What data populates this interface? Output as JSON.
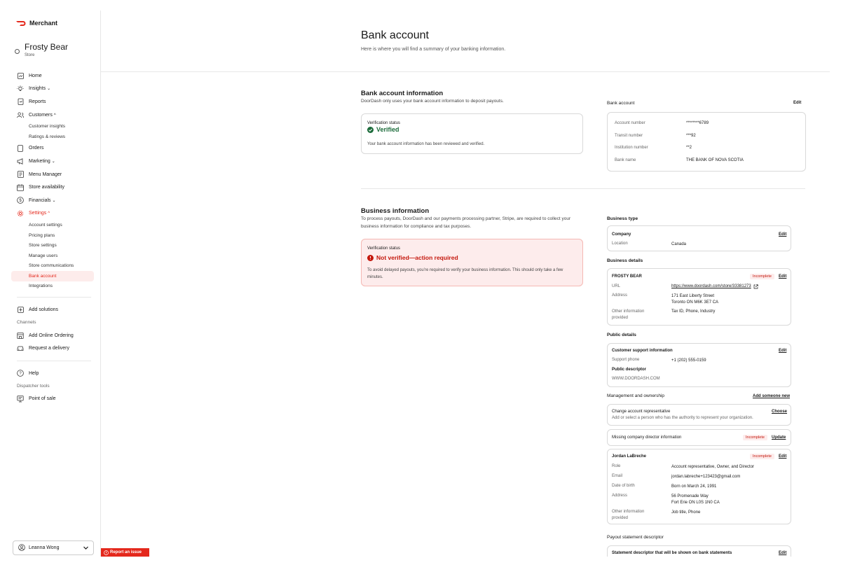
{
  "brand": {
    "name": "Merchant",
    "color": "#e4281c"
  },
  "store": {
    "name": "Frosty Bear",
    "type": "Store"
  },
  "nav": {
    "home": "Home",
    "insights": "Insights",
    "reports": "Reports",
    "customers": "Customers",
    "customer_insights": "Customer insights",
    "ratings_reviews": "Ratings & reviews",
    "orders": "Orders",
    "marketing": "Marketing",
    "menu_manager": "Menu Manager",
    "store_availability": "Store availability",
    "financials": "Financials",
    "settings": "Settings",
    "account_settings": "Account settings",
    "pricing_plans": "Pricing plans",
    "store_settings": "Store settings",
    "manage_users": "Manage users",
    "store_communications": "Store communications",
    "bank_account": "Bank account",
    "integrations": "Integrations",
    "add_solutions": "Add solutions",
    "channels_label": "Channels",
    "add_online_ordering": "Add Online Ordering",
    "request_delivery": "Request a delivery",
    "help": "Help",
    "dispatcher_label": "Dispatcher tools",
    "point_of_sale": "Point of sale"
  },
  "user": {
    "name": "Leanna Wong"
  },
  "report_issue": "Report an issue",
  "page": {
    "title": "Bank account",
    "subtitle": "Here is where you will find a summary of your banking information."
  },
  "bank_info": {
    "heading": "Bank account information",
    "desc": "DoorDash only uses your bank account information to deposit payouts.",
    "status_label": "Verification status",
    "status": "Verified",
    "status_desc": "Your bank account information has been reviewed and verified.",
    "card_title": "Bank account",
    "edit": "Edit",
    "rows": [
      {
        "label": "Account number",
        "value": "********6789"
      },
      {
        "label": "Transit number",
        "value": "***92"
      },
      {
        "label": "Institution number",
        "value": "**2"
      },
      {
        "label": "Bank name",
        "value": "THE BANK OF NOVA SCOTIA"
      }
    ]
  },
  "business": {
    "heading": "Business information",
    "desc": "To process payouts, DoorDash and our payments processing partner, Stripe, are required to collect your business information for compliance and tax purposes.",
    "status_label": "Verification status",
    "status": "Not verified—action required",
    "status_desc": "To avoid delayed payouts, you’re required to verify your business information. This should only take a few minutes.",
    "type": {
      "title": "Business type",
      "name": "Company",
      "edit": "Edit",
      "location_label": "Location",
      "location": "Canada"
    },
    "details": {
      "title": "Business details",
      "name": "FROSTY BEAR",
      "badge": "Incomplete",
      "edit": "Edit",
      "url_label": "URL",
      "url": "https://www.doordash.com/store/33381273",
      "address_label": "Address",
      "address_line1": "171 East Liberty Street",
      "address_line2": "Toronto ON M6K 3E7 CA",
      "other_label_1": "Other information",
      "other_label_2": "provided",
      "other": "Tax ID, Phone, Industry"
    },
    "public": {
      "title": "Public details",
      "support_title": "Customer support information",
      "edit": "Edit",
      "phone_label": "Support phone",
      "phone": "+1 (202) 555-0159",
      "descriptor_title": "Public descriptor",
      "descriptor": "WWW.DOORDASH.COM"
    },
    "management": {
      "title": "Management and ownership",
      "add_new": "Add someone new",
      "rep_title": "Change account representative",
      "rep_desc": "Add or select a person who has the authority to represent your organization.",
      "choose": "Choose",
      "director_title": "Missing company director information",
      "director_badge": "Incomplete",
      "update": "Update",
      "person_name": "Jordan LaBreche",
      "person_badge": "Incomplete",
      "person_edit": "Edit",
      "role_label": "Role",
      "role": "Account representative, Owner, and Director",
      "email_label": "Email",
      "email": "jordan.labreche+123423@gmail.com",
      "dob_label": "Date of birth",
      "dob": "Born on March 24, 1991",
      "address_label": "Address",
      "address_line1": "56 Promenade Way",
      "address_line2": "Fort Erie ON L0S 1N0 CA",
      "other_label_1": "Other information",
      "other_label_2": "provided",
      "other": "Job title, Phone"
    },
    "payout": {
      "title": "Payout statement descriptor",
      "row_title": "Statement descriptor that will be shown on bank statements",
      "edit": "Edit"
    }
  }
}
